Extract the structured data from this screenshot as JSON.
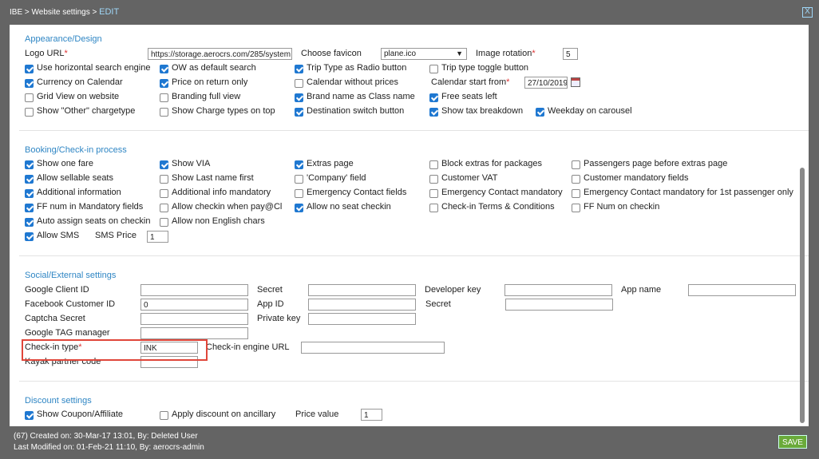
{
  "header": {
    "breadcrumb": "IBE > Website settings >",
    "mode": "EDIT",
    "close_label": "X"
  },
  "appearance": {
    "title": "Appearance/Design",
    "logo_url_label": "Logo URL",
    "logo_url_value": "https://storage.aerocrs.com/285/system",
    "favicon_label": "Choose favicon",
    "favicon_value": "plane.ico",
    "rotation_label": "Image rotation",
    "rotation_value": "5",
    "calendar_start_label": "Calendar start from",
    "calendar_start_value": "27/10/2019",
    "required_mark": "*",
    "options": [
      {
        "label": "Use horizontal search engine",
        "checked": true
      },
      {
        "label": "OW as default search",
        "checked": true
      },
      {
        "label": "Trip Type as Radio button",
        "checked": true
      },
      {
        "label": "Trip type toggle button",
        "checked": false
      },
      {
        "label": "Currency on Calendar",
        "checked": true
      },
      {
        "label": "Price on return only",
        "checked": true
      },
      {
        "label": "Calendar without prices",
        "checked": false
      },
      {
        "label": "Grid View on website",
        "checked": false
      },
      {
        "label": "Branding full view",
        "checked": false
      },
      {
        "label": "Brand name as Class name",
        "checked": true
      },
      {
        "label": "Free seats left",
        "checked": true
      },
      {
        "label": "Show \"Other\" chargetype",
        "checked": false
      },
      {
        "label": "Show Charge types on top",
        "checked": false
      },
      {
        "label": "Destination switch button",
        "checked": true
      },
      {
        "label": "Show tax breakdown",
        "checked": true
      },
      {
        "label": "Weekday on carousel",
        "checked": true
      }
    ]
  },
  "booking": {
    "title": "Booking/Check-in process",
    "sms_price_label": "SMS Price",
    "sms_price_value": "1",
    "options": [
      {
        "label": "Show one fare",
        "checked": true
      },
      {
        "label": "Show VIA",
        "checked": true
      },
      {
        "label": "Extras page",
        "checked": true
      },
      {
        "label": "Block extras for packages",
        "checked": false
      },
      {
        "label": "Passengers page before extras page",
        "checked": false
      },
      {
        "label": "Allow sellable seats",
        "checked": true
      },
      {
        "label": "Show Last name first",
        "checked": false
      },
      {
        "label": "'Company' field",
        "checked": false
      },
      {
        "label": "Customer VAT",
        "checked": false
      },
      {
        "label": "Customer mandatory fields",
        "checked": false
      },
      {
        "label": "Additional information",
        "checked": true
      },
      {
        "label": "Additional info mandatory",
        "checked": false
      },
      {
        "label": "Emergency Contact fields",
        "checked": false
      },
      {
        "label": "Emergency Contact mandatory",
        "checked": false
      },
      {
        "label": "Emergency Contact mandatory for 1st passenger only",
        "checked": false
      },
      {
        "label": "FF num in Mandatory fields",
        "checked": true
      },
      {
        "label": "Allow checkin when pay@Cl",
        "checked": false
      },
      {
        "label": "Allow no seat checkin",
        "checked": true
      },
      {
        "label": "Check-in Terms & Conditions",
        "checked": false
      },
      {
        "label": "FF Num on checkin",
        "checked": false
      },
      {
        "label": "Auto assign seats on checkin",
        "checked": true
      },
      {
        "label": "Allow non English chars",
        "checked": false
      },
      {
        "label": "Allow SMS",
        "checked": true
      }
    ]
  },
  "social": {
    "title": "Social/External settings",
    "fields": {
      "google_client_id": {
        "label": "Google Client ID",
        "value": ""
      },
      "google_secret": {
        "label": "Secret",
        "value": ""
      },
      "developer_key": {
        "label": "Developer key",
        "value": ""
      },
      "app_name": {
        "label": "App name",
        "value": ""
      },
      "facebook_customer_id": {
        "label": "Facebook Customer ID",
        "value": "0"
      },
      "app_id": {
        "label": "App ID",
        "value": ""
      },
      "facebook_secret": {
        "label": "Secret",
        "value": ""
      },
      "captcha_secret": {
        "label": "Captcha Secret",
        "value": ""
      },
      "private_key": {
        "label": "Private key",
        "value": ""
      },
      "google_tag_manager": {
        "label": "Google TAG manager",
        "value": ""
      },
      "checkin_type": {
        "label": "Check-in type",
        "value": "INK"
      },
      "checkin_engine_url": {
        "label": "Check-in engine URL",
        "value": ""
      },
      "kayak_partner_code": {
        "label": "Kayak partner code",
        "value": ""
      }
    }
  },
  "discount": {
    "title": "Discount settings",
    "show_coupon": {
      "label": "Show Coupon/Affiliate",
      "checked": true
    },
    "apply_discount": {
      "label": "Apply discount on ancillary",
      "checked": false
    },
    "price_value_label": "Price value",
    "price_value": "1"
  },
  "footer": {
    "created": "(67) Created on: 30-Mar-17 13:01, By: Deleted User",
    "modified": "Last Modified on: 01-Feb-21 11:10, By: aerocrs-admin",
    "save_label": "SAVE"
  },
  "colors": {
    "accent": "#2f86c4",
    "highlight": "#e0463a",
    "save": "#6aaa3a"
  }
}
